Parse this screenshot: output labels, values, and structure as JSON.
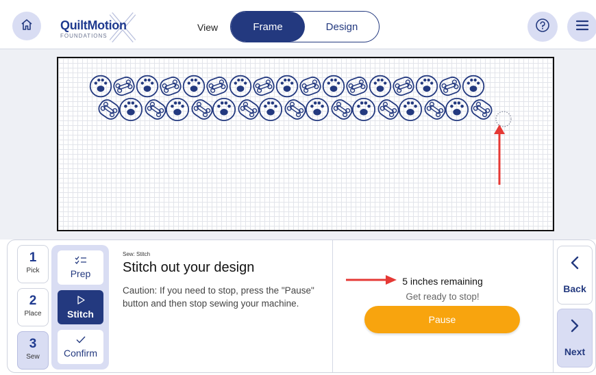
{
  "header": {
    "logo_main": "QuiltMotion",
    "logo_sub": "FOUNDATIONS",
    "view_label": "View",
    "toggle": {
      "frame": "Frame",
      "design": "Design",
      "active": "Frame"
    }
  },
  "steps": [
    {
      "num": "1",
      "label": "Pick",
      "active": false
    },
    {
      "num": "2",
      "label": "Place",
      "active": false
    },
    {
      "num": "3",
      "label": "Sew",
      "active": true
    }
  ],
  "substeps": [
    {
      "icon": "checklist-icon",
      "label": "Prep",
      "active": false
    },
    {
      "icon": "play-icon",
      "label": "Stitch",
      "active": true
    },
    {
      "icon": "check-icon",
      "label": "Confirm",
      "active": false
    }
  ],
  "instructions": {
    "crumb": "Sew: Stitch",
    "title": "Stitch out your design",
    "body": "Caution: If you need to stop, press the \"Pause\" button and then stop sewing your machine."
  },
  "status": {
    "remaining": "5 inches remaining",
    "ready": "Get ready to stop!",
    "pause_label": "Pause"
  },
  "nav": {
    "back": "Back",
    "next": "Next"
  },
  "colors": {
    "navy": "#23397f",
    "lavender": "#d9ddf3",
    "orange": "#f8a40e",
    "arrow_red": "#e53935"
  }
}
